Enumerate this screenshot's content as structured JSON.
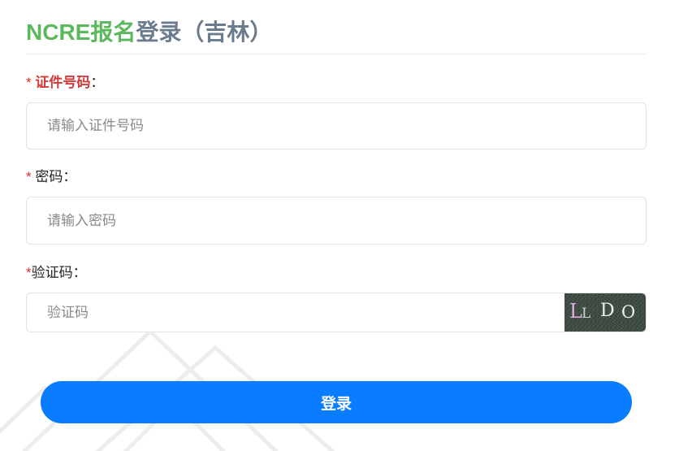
{
  "page": {
    "title_highlight": "NCRE报名",
    "title_rest": "登录（吉林）"
  },
  "form": {
    "fields": [
      {
        "required_mark": "* ",
        "label": "证件号码",
        "colon": "：",
        "value": "",
        "placeholder": "请输入证件号码"
      },
      {
        "required_mark": "* ",
        "label": "密码",
        "colon": "：",
        "value": "",
        "placeholder": "请输入密码"
      },
      {
        "required_mark": "*",
        "label": "验证码",
        "colon": "：",
        "value": "",
        "placeholder": "验证码"
      }
    ],
    "captcha": {
      "chars": [
        "L",
        "L",
        "D",
        "O"
      ]
    },
    "submit_label": "登录"
  },
  "colors": {
    "brand_green": "#5cb85c",
    "title_gray": "#6b7b8e",
    "required_red": "#e32626",
    "primary_blue": "#0a7cff"
  }
}
